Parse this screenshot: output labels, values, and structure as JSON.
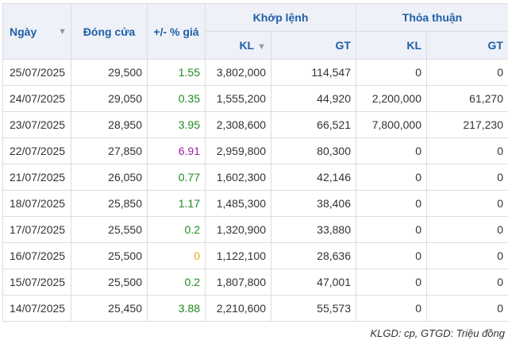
{
  "headers": {
    "ngay": "Ngày",
    "dong_cua": "Đóng cửa",
    "thay_doi": "+/- % giá",
    "khop_lenh": "Khớp lệnh",
    "thoa_thuan": "Thỏa thuận",
    "kl": "KL",
    "gt": "GT",
    "sort_icon": "triangle-down"
  },
  "rows": [
    {
      "date": "25/07/2025",
      "close": "29,500",
      "change": "1.55",
      "change_color": "up",
      "kl1": "3,802,000",
      "gt1": "114,547",
      "kl2": "0",
      "gt2": "0"
    },
    {
      "date": "24/07/2025",
      "close": "29,050",
      "change": "0.35",
      "change_color": "up",
      "kl1": "1,555,200",
      "gt1": "44,920",
      "kl2": "2,200,000",
      "gt2": "61,270"
    },
    {
      "date": "23/07/2025",
      "close": "28,950",
      "change": "3.95",
      "change_color": "up",
      "kl1": "2,308,600",
      "gt1": "66,521",
      "kl2": "7,800,000",
      "gt2": "217,230"
    },
    {
      "date": "22/07/2025",
      "close": "27,850",
      "change": "6.91",
      "change_color": "ceil",
      "kl1": "2,959,800",
      "gt1": "80,300",
      "kl2": "0",
      "gt2": "0"
    },
    {
      "date": "21/07/2025",
      "close": "26,050",
      "change": "0.77",
      "change_color": "up",
      "kl1": "1,602,300",
      "gt1": "42,146",
      "kl2": "0",
      "gt2": "0"
    },
    {
      "date": "18/07/2025",
      "close": "25,850",
      "change": "1.17",
      "change_color": "up",
      "kl1": "1,485,300",
      "gt1": "38,406",
      "kl2": "0",
      "gt2": "0"
    },
    {
      "date": "17/07/2025",
      "close": "25,550",
      "change": "0.2",
      "change_color": "up",
      "kl1": "1,320,900",
      "gt1": "33,880",
      "kl2": "0",
      "gt2": "0"
    },
    {
      "date": "16/07/2025",
      "close": "25,500",
      "change": "0",
      "change_color": "flat",
      "kl1": "1,122,100",
      "gt1": "28,636",
      "kl2": "0",
      "gt2": "0"
    },
    {
      "date": "15/07/2025",
      "close": "25,500",
      "change": "0.2",
      "change_color": "up",
      "kl1": "1,807,800",
      "gt1": "47,001",
      "kl2": "0",
      "gt2": "0"
    },
    {
      "date": "14/07/2025",
      "close": "25,450",
      "change": "3.88",
      "change_color": "up",
      "kl1": "2,210,600",
      "gt1": "55,573",
      "kl2": "0",
      "gt2": "0"
    }
  ],
  "colors": {
    "up": "#1f8a1f",
    "ceil": "#a020a0",
    "flat": "#f39c12",
    "header_text": "#1f5fa8",
    "header_bg": "#eef1f7"
  },
  "note": "KLGD: cp, GTGD: Triệu đồng"
}
